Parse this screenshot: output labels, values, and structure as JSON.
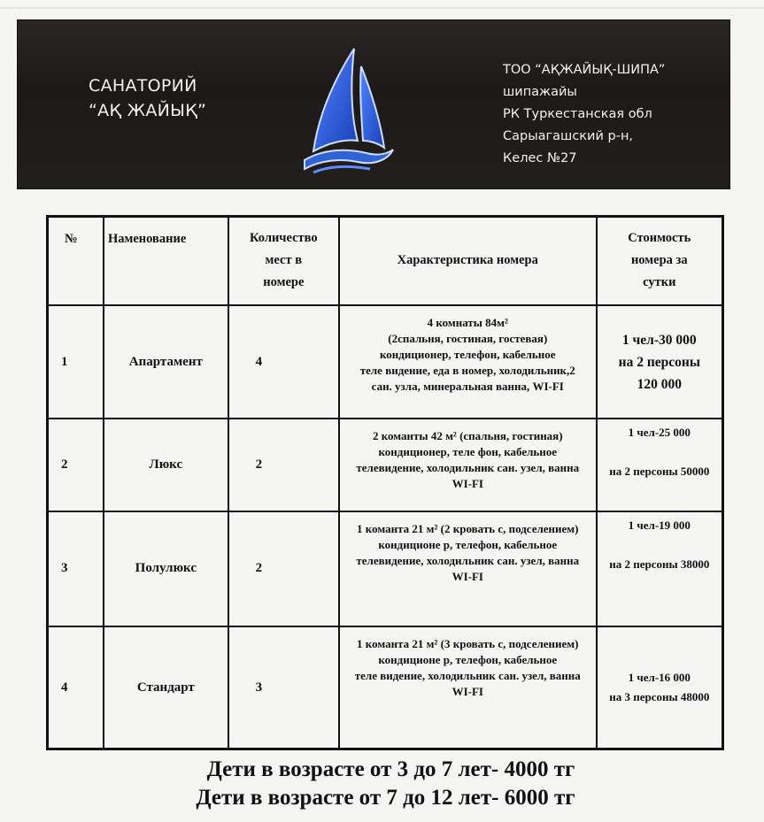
{
  "header": {
    "name_line1": "САНАТОРИЙ",
    "name_line2": "“АҚ ЖАЙЫҚ”",
    "address": [
      "ТОО “АҚЖАЙЫҚ-ШИПА” шипажайы",
      "РК Туркестанская обл",
      "Сарыагашский р-н,",
      "Келес №27"
    ],
    "logo_icon": "sailboat-logo-icon",
    "accent_color": "#2f63d6"
  },
  "table": {
    "headers": {
      "no": "№",
      "name": "Наменование",
      "qty": [
        "Количество",
        "мест в",
        "номере"
      ],
      "desc": "Характеристика номера",
      "price": [
        "Стоимость",
        "номера за",
        "сутки"
      ]
    },
    "rows": [
      {
        "no": "1",
        "name": "Апартамент",
        "qty": "4",
        "desc": [
          "4 комнаты 84м²",
          "(2спальня, гостиная, гостевая)",
          "кондиционер, телефон, кабельное",
          "теле видение, еда в номер, холодильник,2",
          "сан. узла, минеральная ванна, WI-FI"
        ],
        "price": [
          "1 чел-30 000",
          "на 2 персоны",
          "120 000"
        ]
      },
      {
        "no": "2",
        "name": "Люкс",
        "qty": "2",
        "desc": [
          "2 команты 42 м² (спальня, гостиная)",
          "кондиционер, теле фон, кабельное",
          "телевидение, холодильник сан. узел, ванна",
          "WI-FI"
        ],
        "price": [
          "1 чел-25 000",
          "на 2 персоны 50000"
        ]
      },
      {
        "no": "3",
        "name": "Полулюкс",
        "qty": "2",
        "desc": [
          "1 команта 21 м² (2 кровать с, подселением)",
          "кондиционе р, телефон, кабельное",
          "телевидение, холодильник сан. узел, ванна",
          "WI-FI"
        ],
        "price": [
          "1 чел-19 000",
          "на 2 персоны 38000"
        ]
      },
      {
        "no": "4",
        "name": "Стандарт",
        "qty": "3",
        "desc": [
          "1 команта 21 м² (3 кровать с, подселением)",
          "кондиционе р, телефон, кабельное",
          "теле видение, холодильник сан. узел, ванна",
          "WI-FI"
        ],
        "price": [
          "1 чел-16 000",
          "на 3 персоны 48000"
        ]
      }
    ]
  },
  "footer": {
    "line1": "Дети в возрасте от 3 до 7 лет- 4000 тг",
    "line2": "Дети в возрасте от 7 до 12 лет- 6000 тг"
  }
}
